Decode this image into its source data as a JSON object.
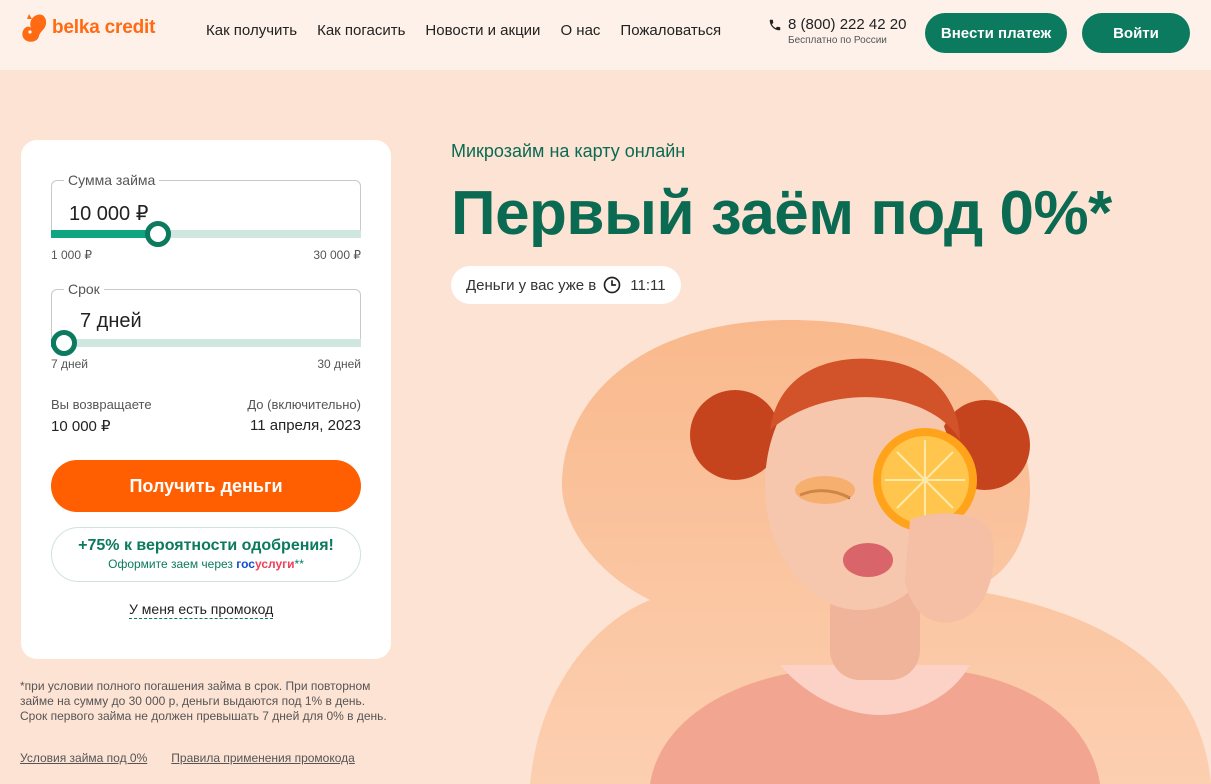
{
  "header": {
    "logo_text": "belka credit",
    "nav": [
      "Как получить",
      "Как погасить",
      "Новости и акции",
      "О нас",
      "Пожаловаться"
    ],
    "phone": "8 (800) 222 42 20",
    "phone_note": "Бесплатно по России",
    "pay_button": "Внести платеж",
    "login_button": "Войти"
  },
  "calculator": {
    "amount": {
      "label": "Сумма займа",
      "value": "10 000 ₽",
      "min": "1 000 ₽",
      "max": "30 000 ₽",
      "level": 0.33
    },
    "term": {
      "label": "Срок",
      "value": "7 дней",
      "min": "7 дней",
      "max": "30 дней",
      "level": 0.0
    },
    "return_label": "Вы возвращаете",
    "return_value": "10 000 ₽",
    "until_label": "До (включительно)",
    "until_value": "11 апреля, 2023",
    "submit": "Получить деньги",
    "gos_title": "+75% к вероятности одобрения!",
    "gos_sub": "Оформите заем через",
    "gos_brand_a": "гос",
    "gos_brand_b": "услуги",
    "gos_mark": "**",
    "promo": "У меня есть промокод"
  },
  "footnote": "*при условии полного погашения займа в срок. При повторном займе на сумму до 30 000 р, деньги выдаются под 1% в день. Срок первого займа не должен превышать 7 дней для 0% в день.",
  "footer_links": [
    "Условия займа под 0%",
    "Правила применения промокода"
  ],
  "hero": {
    "subtitle": "Микрозайм на карту онлайн",
    "title": "Первый заём под 0%*",
    "pill_text": "Деньги у вас уже в",
    "pill_time": "11:11"
  },
  "colors": {
    "brand_orange": "#ff5f00",
    "brand_green": "#0b7a5e",
    "page_bg": "#fde3d4"
  }
}
